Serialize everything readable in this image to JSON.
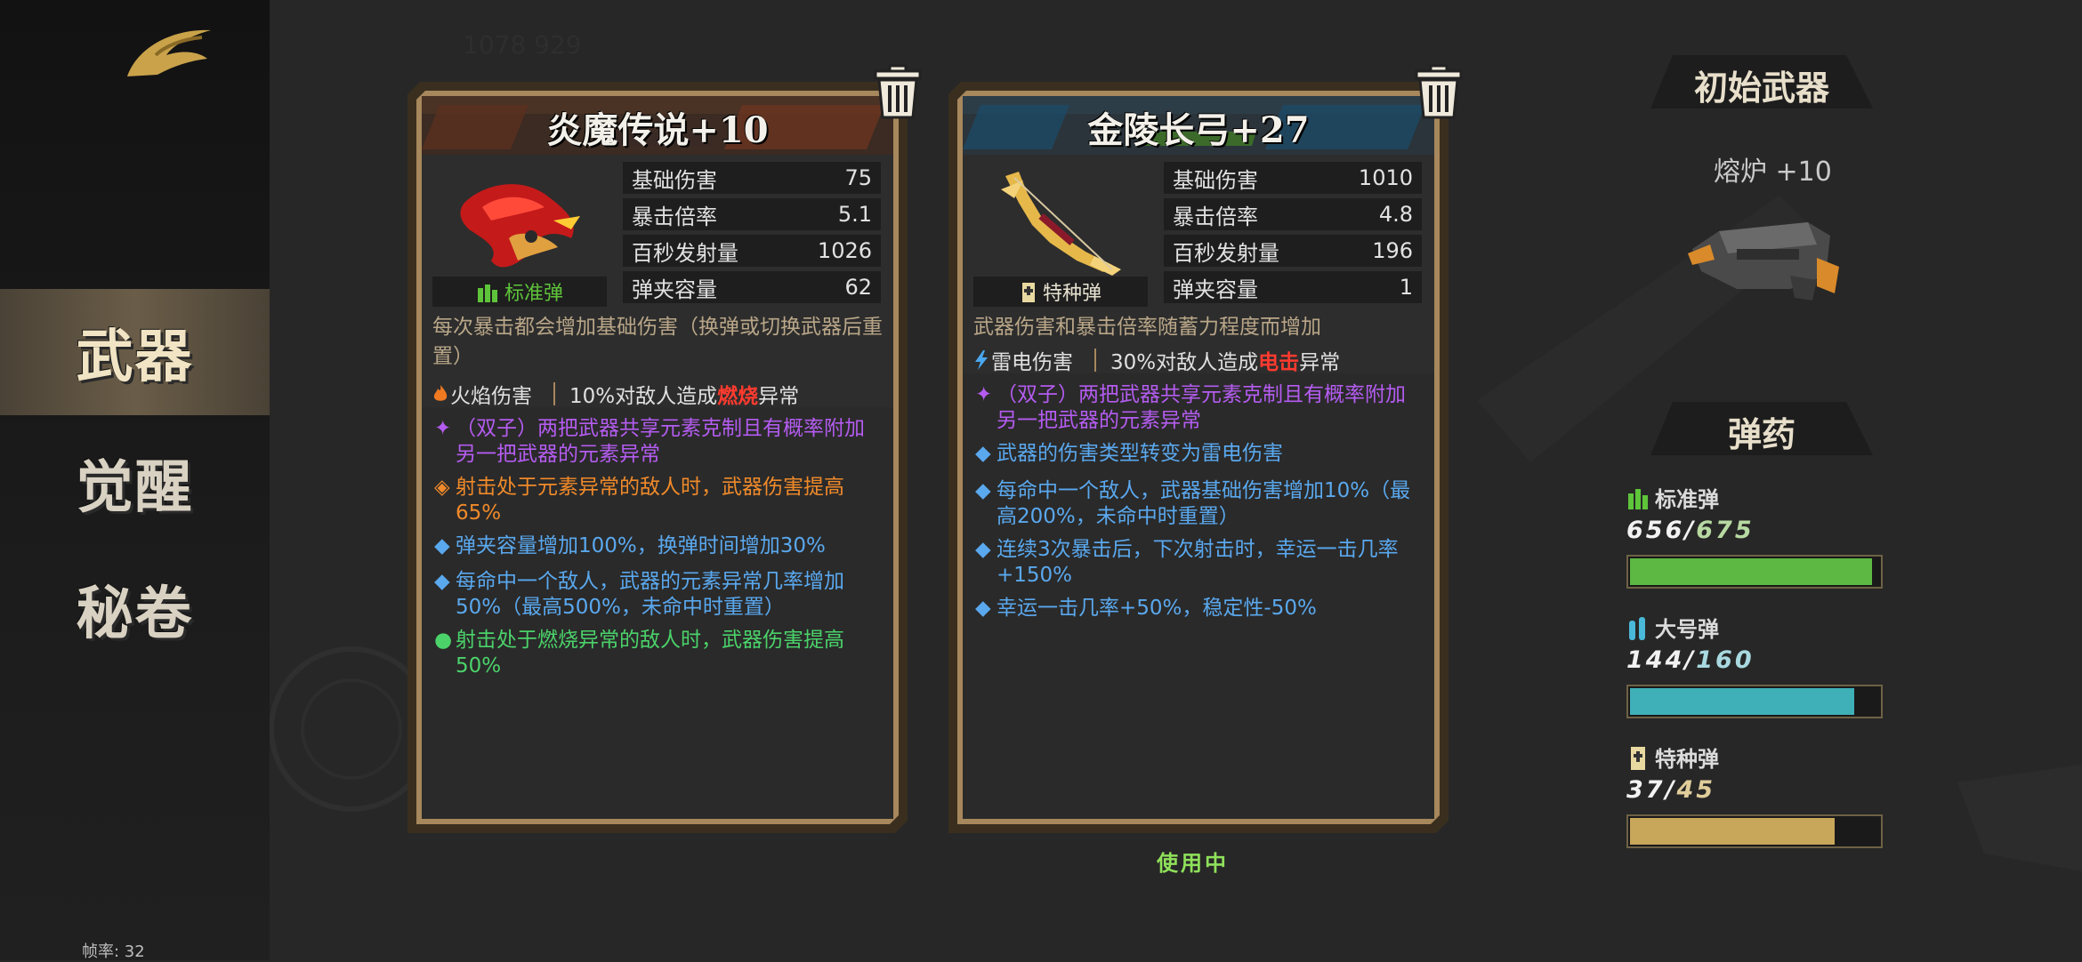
{
  "sidebar": {
    "nav": [
      {
        "label": "武器",
        "active": true
      },
      {
        "label": "觉醒",
        "active": false
      },
      {
        "label": "秘卷",
        "active": false
      }
    ],
    "fps_label": "帧率: 32"
  },
  "weapons": [
    {
      "title": "炎魔传说+10",
      "ammo_type": "标准弹",
      "ammo_color": "#5ec43a",
      "stats": [
        {
          "label": "基础伤害",
          "value": "75"
        },
        {
          "label": "暴击倍率",
          "value": "5.1"
        },
        {
          "label": "百秒发射量",
          "value": "1026"
        },
        {
          "label": "弹夹容量",
          "value": "62"
        }
      ],
      "description": "每次暴击都会增加基础伤害（换弹或切换武器后重置）",
      "damage_type": "火焰伤害",
      "status_pre": "10%对敌人造成",
      "status_name": "燃烧",
      "status_post": "异常",
      "perks": [
        {
          "bullet": "✦",
          "text": "（双子）两把武器共享元素克制且有概率附加另一把武器的元素异常",
          "color": "#b45cf0"
        },
        {
          "bullet": "◈",
          "text": "射击处于元素异常的敌人时，武器伤害提高65%",
          "color": "#f08a2a"
        },
        {
          "bullet": "◆",
          "text": "弹夹容量增加100%，换弹时间增加30%",
          "color": "#5aa8ee"
        },
        {
          "bullet": "◆",
          "text": "每命中一个敌人，武器的元素异常几率增加50%（最高500%，未命中时重置）",
          "color": "#5aa8ee"
        },
        {
          "bullet": "●",
          "text": "射击处于燃烧异常的敌人时，武器伤害提高50%",
          "color": "#4bd36a"
        }
      ]
    },
    {
      "title": "金陵长弓+27",
      "ammo_type": "特种弹",
      "ammo_color": "#e8e3d2",
      "stats": [
        {
          "label": "基础伤害",
          "value": "1010"
        },
        {
          "label": "暴击倍率",
          "value": "4.8"
        },
        {
          "label": "百秒发射量",
          "value": "196"
        },
        {
          "label": "弹夹容量",
          "value": "1"
        }
      ],
      "description": "武器伤害和暴击倍率随蓄力程度而增加",
      "damage_type": "雷电伤害",
      "status_pre": "30%对敌人造成",
      "status_name": "电击",
      "status_post": "异常",
      "perks": [
        {
          "bullet": "✦",
          "text": "（双子）两把武器共享元素克制且有概率附加另一把武器的元素异常",
          "color": "#b45cf0"
        },
        {
          "bullet": "◆",
          "text": "武器的伤害类型转变为雷电伤害",
          "color": "#5aa8ee"
        },
        {
          "bullet": "◆",
          "text": "每命中一个敌人，武器基础伤害增加10%（最高200%，未命中时重置）",
          "color": "#5aa8ee"
        },
        {
          "bullet": "◆",
          "text": "连续3次暴击后，下次射击时，幸运一击几率+150%",
          "color": "#5aa8ee"
        },
        {
          "bullet": "◆",
          "text": "幸运一击几率+50%，稳定性-50%",
          "color": "#5aa8ee"
        }
      ],
      "in_use_label": "使用中"
    }
  ],
  "initial_weapon": {
    "title": "初始武器",
    "name": "熔炉  +10"
  },
  "ammo": {
    "title": "弹药",
    "types": [
      {
        "name": "标准弹",
        "current": "656",
        "max": "675",
        "fraction": 0.972,
        "color": "#5cb843"
      },
      {
        "name": "大号弹",
        "current": "144",
        "max": "160",
        "fraction": 0.9,
        "color": "#3fb0b8"
      },
      {
        "name": "特种弹",
        "current": "37",
        "max": "45",
        "fraction": 0.822,
        "color": "#c8a75a"
      }
    ]
  }
}
